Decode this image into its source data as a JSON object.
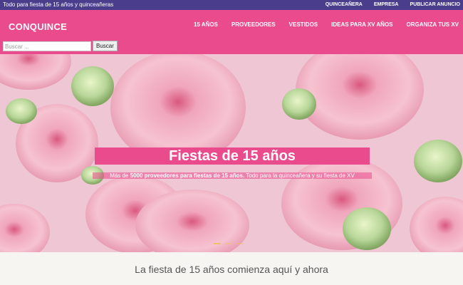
{
  "topbar": {
    "tagline": "Todo para fiesta de 15 años y quinceañeras",
    "links": [
      "QUINCEAÑERA",
      "EMPRESA",
      "PUBLICAR ANUNCIO"
    ]
  },
  "header": {
    "logo": "CONQUINCE",
    "nav": [
      "15 AÑOS",
      "PROVEEDORES",
      "VESTIDOS",
      "IDEAS PARA XV AÑOS",
      "ORGANIZA TUS XV"
    ]
  },
  "search": {
    "placeholder": "Buscar ...",
    "button": "Buscar"
  },
  "hero": {
    "title": "Fiestas de 15 años",
    "subtitle_pre": "Más de ",
    "subtitle_bold": "5000 proveedores para fiestas de 15 años.",
    "subtitle_post": " Todo para la quinceañera y su fiesta de XV"
  },
  "section": {
    "title": "La fiesta de 15 años comienza aquí y ahora"
  },
  "colors": {
    "topbar": "#4a3d8c",
    "brand_pink": "#ea4b8c"
  }
}
